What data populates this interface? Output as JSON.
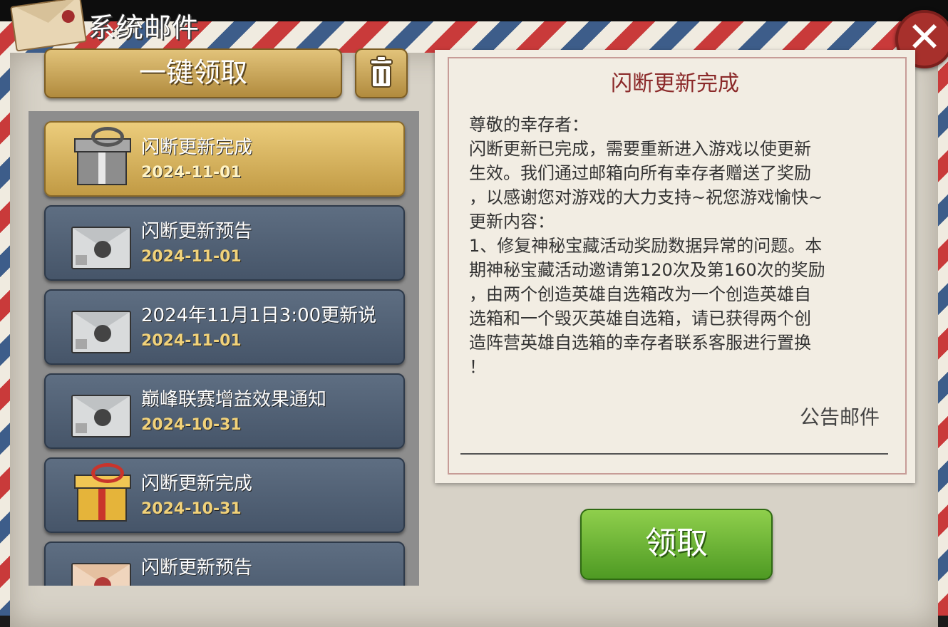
{
  "header": {
    "title": "系统邮件"
  },
  "toolbar": {
    "claim_all_label": "一键领取"
  },
  "mails": [
    {
      "title": "闪断更新完成",
      "date": "2024-11-01",
      "icon": "gift-gray-icon",
      "selected": true
    },
    {
      "title": "闪断更新预告",
      "date": "2024-11-01",
      "icon": "envelope-icon",
      "selected": false
    },
    {
      "title": "2024年11月1日3:00更新说",
      "date": "2024-11-01",
      "icon": "envelope-icon",
      "selected": false
    },
    {
      "title": "巅峰联赛增益效果通知",
      "date": "2024-10-31",
      "icon": "envelope-icon",
      "selected": false
    },
    {
      "title": "闪断更新完成",
      "date": "2024-10-31",
      "icon": "gift-gold-icon",
      "selected": false
    },
    {
      "title": "闪断更新预告",
      "date": "",
      "icon": "envelope-peach-icon",
      "selected": false
    }
  ],
  "detail": {
    "title": "闪断更新完成",
    "body": [
      "尊敬的幸存者：",
      "闪断更新已完成，需要重新进入游戏以使更新",
      "生效。我们通过邮箱向所有幸存者赠送了奖励",
      "，以感谢您对游戏的大力支持~祝您游戏愉快~",
      "更新内容：",
      "1、修复神秘宝藏活动奖励数据异常的问题。本",
      "期神秘宝藏活动邀请第120次及第160次的奖励",
      "，由两个创造英雄自选箱改为一个创造英雄自",
      "选箱和一个毁灭英雄自选箱，请已获得两个创",
      "造阵营英雄自选箱的幸存者联系客服进行置换",
      "！"
    ],
    "footer": "公告邮件"
  },
  "actions": {
    "claim_label": "领取"
  },
  "colors": {
    "accent_gold": "#c19a44",
    "claim_green": "#5fae2e",
    "title_red": "#8b2a2a"
  }
}
